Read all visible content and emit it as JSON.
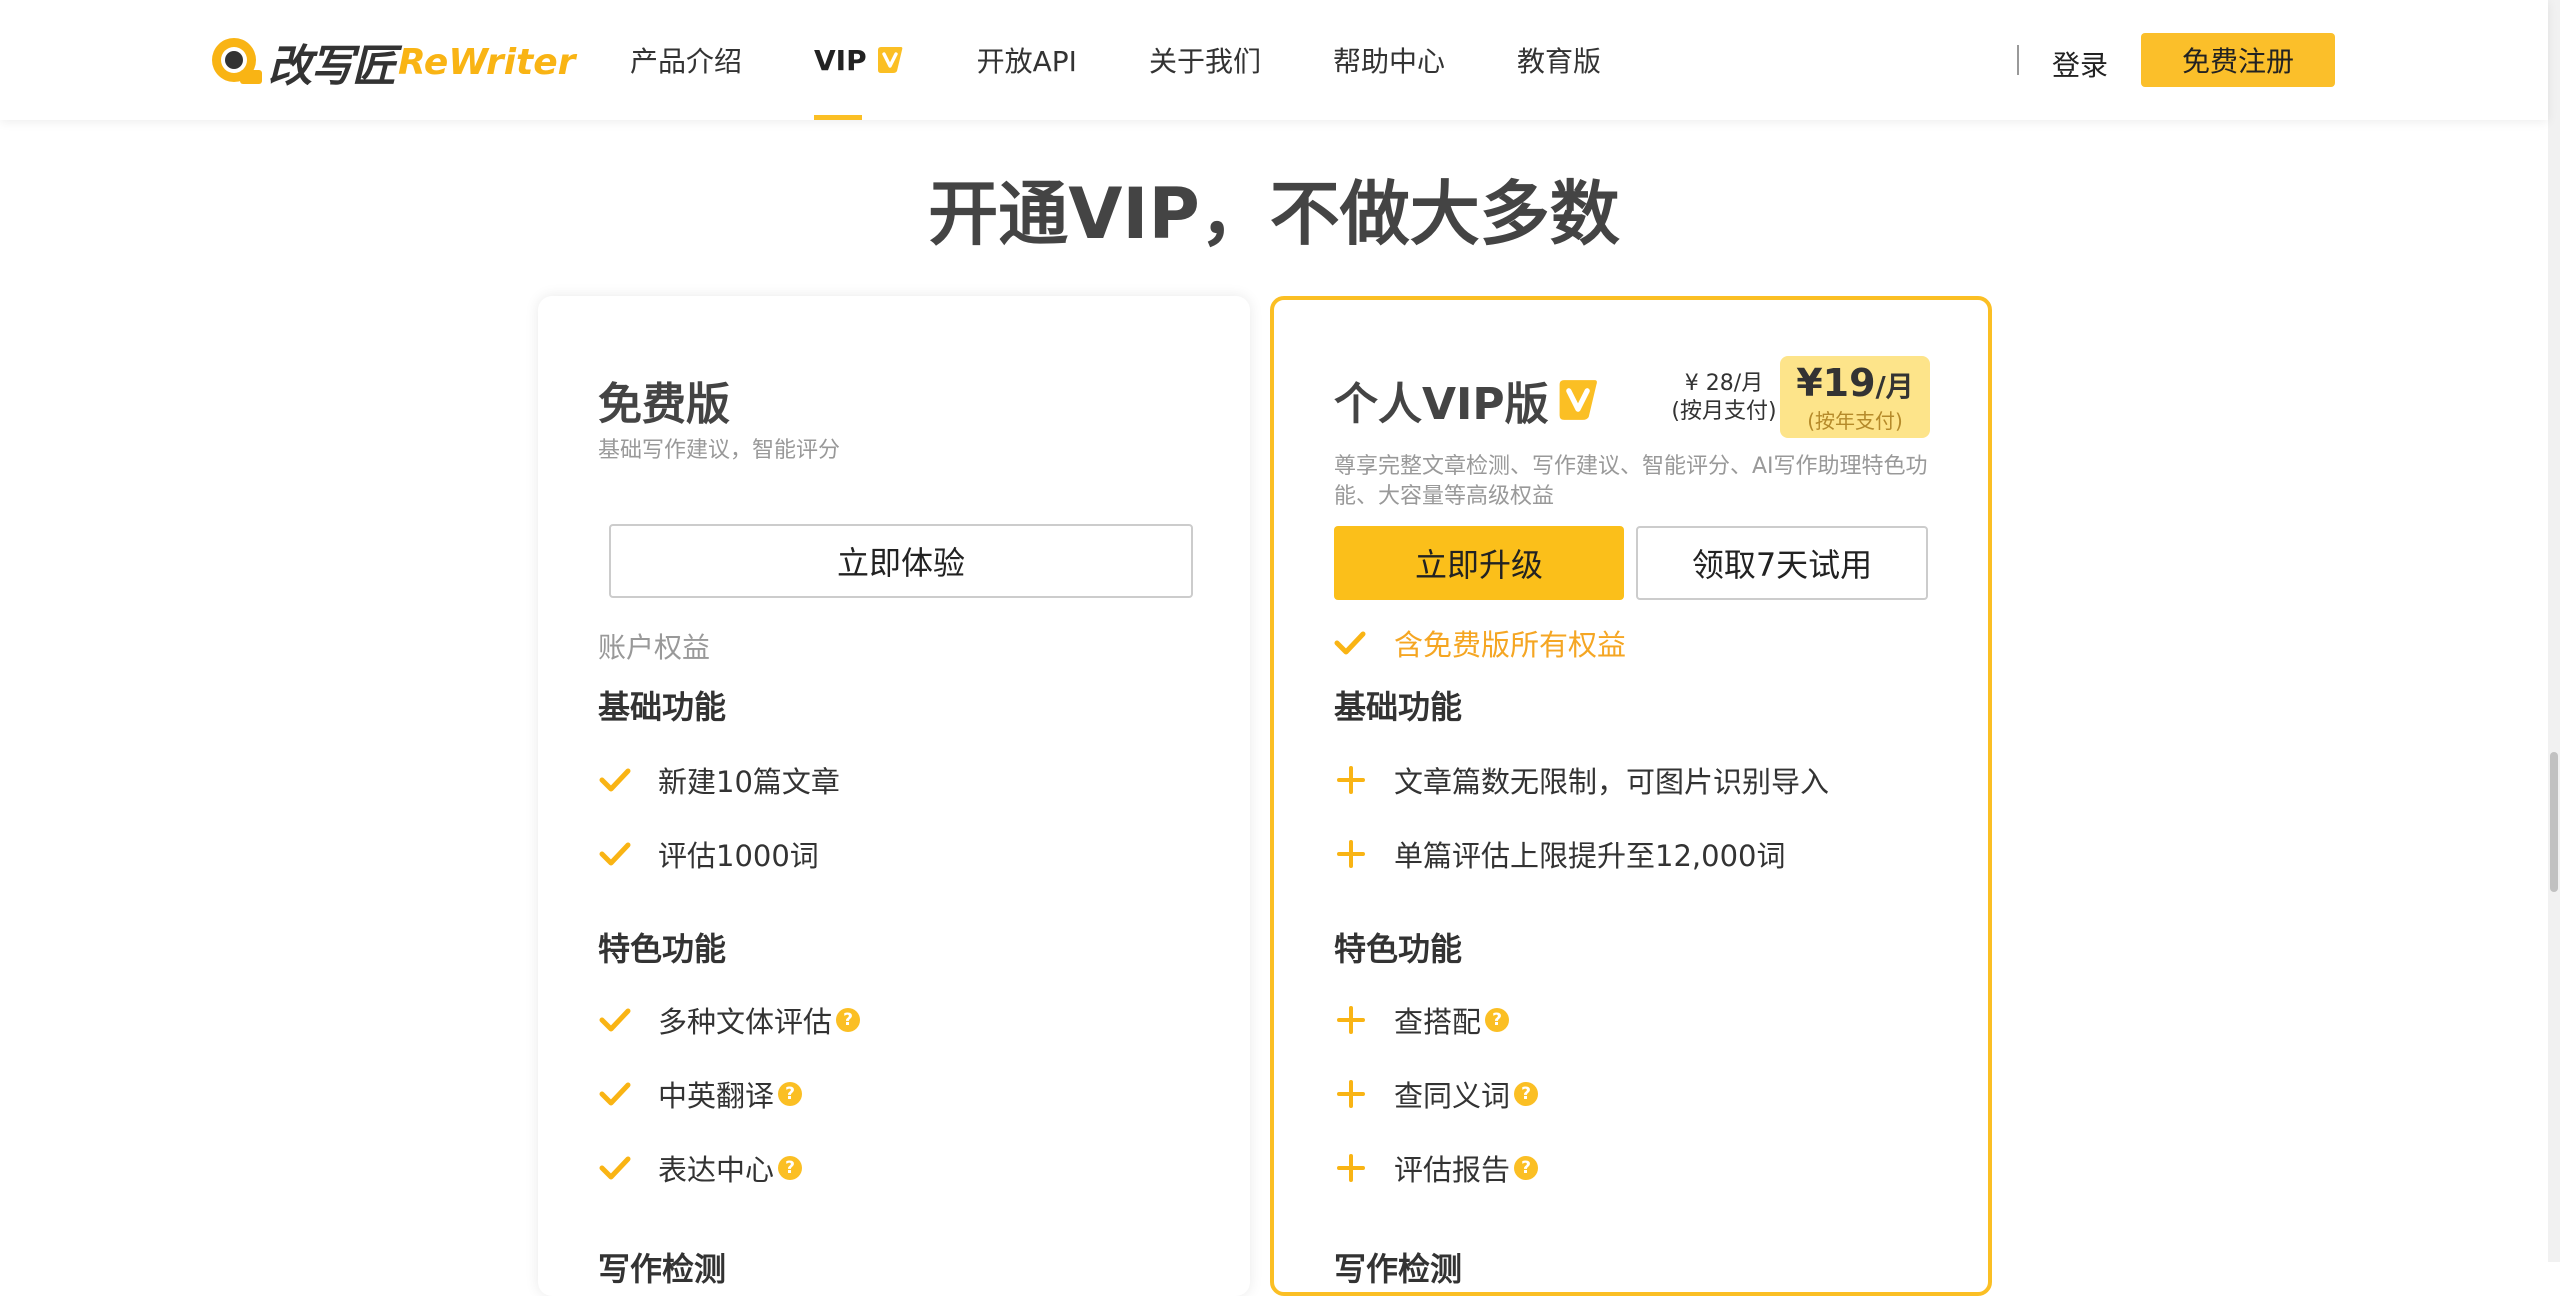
{
  "header": {
    "logo_cn": "改写匠",
    "logo_en": "ReWriter",
    "nav": [
      {
        "label": "产品介绍"
      },
      {
        "label": "VIP"
      },
      {
        "label": "开放API"
      },
      {
        "label": "关于我们"
      },
      {
        "label": "帮助中心"
      },
      {
        "label": "教育版"
      }
    ],
    "login": "登录",
    "register": "免费注册"
  },
  "page_title": "开通VIP，不做大多数",
  "free_plan": {
    "title": "免费版",
    "desc": "基础写作建议，智能评分",
    "button": "立即体验",
    "rights_label": "账户权益",
    "basic_head": "基础功能",
    "basic": [
      "新建10篇文章",
      "评估1000词"
    ],
    "special_head": "特色功能",
    "special": [
      "多种文体评估",
      "中英翻译",
      "表达中心"
    ],
    "next_head": "写作检测"
  },
  "vip_plan": {
    "title": "个人VIP版",
    "price_month": "¥ 28/月",
    "price_month_note": "(按月支付)",
    "price_year_symbol": "¥",
    "price_year": "19",
    "price_year_unit": "/月",
    "price_year_note": "(按年支付)",
    "desc_line1": "尊享完整文章检测、写作建议、智能评分、AI写作助理特色功",
    "desc_line2": "能、大容量等高级权益",
    "upgrade_button": "立即升级",
    "trial_button": "领取7天试用",
    "include_all": "含免费版所有权益",
    "basic_head": "基础功能",
    "basic": [
      "文章篇数无限制，可图片识别导入",
      "单篇评估上限提升至12,000词"
    ],
    "special_head": "特色功能",
    "special": [
      "查搭配",
      "查同义词",
      "评估报告"
    ],
    "next_head": "写作检测"
  },
  "help_glyph": "?",
  "colors": {
    "accent": "#fbbf24",
    "check": "#f9b414",
    "text": "#333333"
  },
  "icons": {
    "check": "check-icon",
    "plus": "plus-icon",
    "help": "help-icon",
    "vip": "vip-badge-icon"
  }
}
